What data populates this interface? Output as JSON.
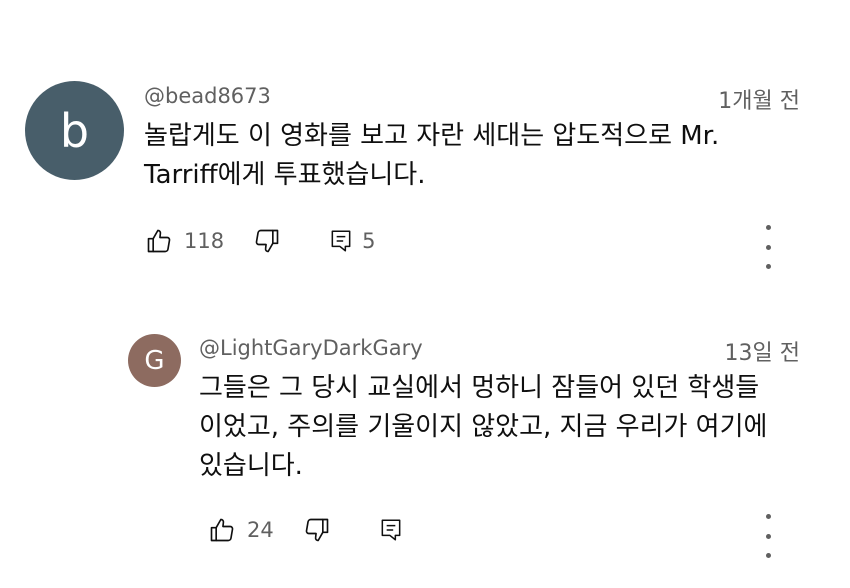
{
  "comments": [
    {
      "avatar_letter": "b",
      "avatar_color": "#485E6A",
      "author": "@bead8673",
      "time": "1개월 전",
      "lines": [
        "놀랍게도 이 영화를 보고 자란 세대는 압도적으로 Mr.",
        "Tarriff에게 투표했습니다."
      ],
      "likes": "118",
      "replies": "5"
    },
    {
      "avatar_letter": "G",
      "avatar_color": "#8D6B60",
      "author": "@LightGaryDarkGary",
      "time": "13일 전",
      "lines": [
        "그들은 그 당시 교실에서 멍하니 잠들어 있던 학생들",
        "이었고, 주의를 기울이지 않았고, 지금 우리가 여기에",
        "있습니다."
      ],
      "likes": "24"
    }
  ],
  "icons": {
    "like": "thumbs-up-icon",
    "dislike": "thumbs-down-icon",
    "reply": "reply-comment-icon",
    "menu": "more-vert-icon"
  }
}
